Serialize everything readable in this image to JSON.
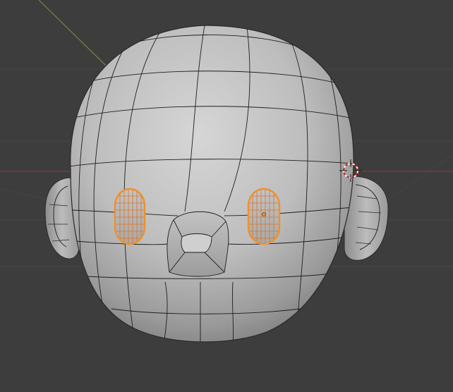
{
  "app": {
    "name": "3D viewport",
    "mode": "edit-mode"
  },
  "viewport": {
    "background_color": "#3d3d3d",
    "grid_color": "#474747",
    "x_axis_color": "#8a3a44",
    "y_axis_color": "#6b8a3a",
    "mesh_color": "#b8b8b8",
    "wire_color": "#1e1e1e",
    "selection_color": "#f0902a",
    "objects": [
      {
        "name": "head-mesh",
        "icon": "mesh-icon"
      },
      {
        "name": "left-eye-mesh",
        "icon": "mesh-icon",
        "selected": true
      },
      {
        "name": "right-eye-mesh",
        "icon": "mesh-icon",
        "selected": true
      }
    ],
    "cursor_icon": "3d-cursor-icon"
  }
}
